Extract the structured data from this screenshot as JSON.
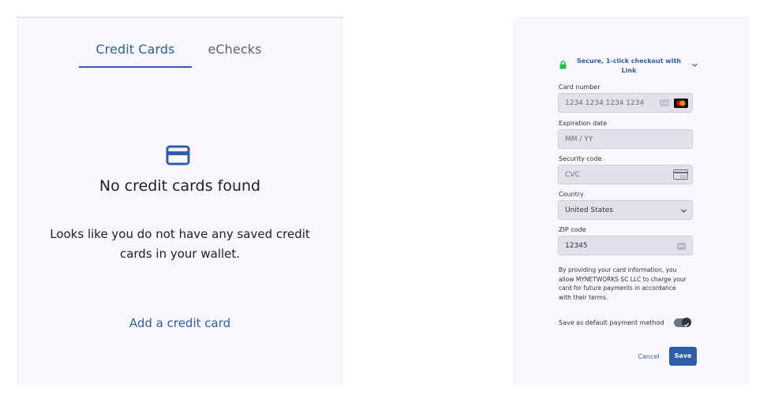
{
  "colors": {
    "accent": "#2e5ea5",
    "link_green": "#21bd4d",
    "link_text": "#2e5ea5",
    "muted_text": "#5f6368"
  },
  "wallet": {
    "tabs": [
      {
        "label": "Credit Cards",
        "selected": true
      },
      {
        "label": "eChecks",
        "selected": false
      }
    ],
    "empty_icon": "credit-card-icon",
    "empty_title": "No credit cards found",
    "empty_description": "Looks like you do not have any saved credit cards in your wallet.",
    "add_link": "Add a credit card"
  },
  "payment_form": {
    "link_checkout": {
      "icon": "lock-icon",
      "text": "Secure, 1-click checkout with Link",
      "chevron": "chevron-down-icon"
    },
    "card_number": {
      "label": "Card number",
      "placeholder": "1234 1234 1234 1234",
      "icons": [
        "card-brand-placeholder-icon",
        "mastercard-icon"
      ]
    },
    "expiration": {
      "label": "Expiration date",
      "placeholder": "MM / YY"
    },
    "security_code": {
      "label": "Security code",
      "placeholder": "CVC",
      "icon": "cvc-card-icon",
      "icon_text": "123"
    },
    "country": {
      "label": "Country",
      "value": "United States",
      "icon": "chevron-down-icon"
    },
    "zip": {
      "label": "ZIP code",
      "value": "12345",
      "icon": "autofill-icon"
    },
    "terms": "By providing your card information, you allow MYNETWORKS SC LLC to charge your card for future payments in accordance with their terms.",
    "save_default": {
      "label": "Save as default payment method",
      "checked": true
    },
    "cancel_label": "Cancel",
    "save_label": "Save"
  }
}
